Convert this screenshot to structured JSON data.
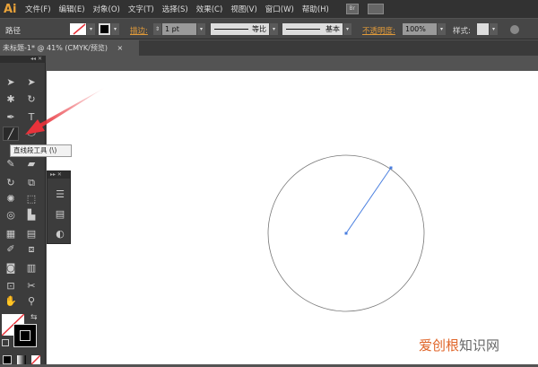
{
  "app": {
    "logo": "Ai",
    "menus": [
      "文件(F)",
      "编辑(E)",
      "对象(O)",
      "文字(T)",
      "选择(S)",
      "效果(C)",
      "视图(V)",
      "窗口(W)",
      "帮助(H)"
    ],
    "bridge": "Br"
  },
  "control": {
    "selection": "路径",
    "stroke_label": "描边:",
    "stroke_weight": "1 pt",
    "profile": "等比",
    "brush": "基本",
    "opacity_label": "不透明度:",
    "opacity": "100%",
    "style_label": "样式:"
  },
  "tab": {
    "title": "未标题-1* @ 41% (CMYK/预览)",
    "close": "×"
  },
  "tooltip": "直线段工具 (\\)",
  "watermark": {
    "part1": "爱创根",
    "part2": "知识网"
  },
  "colors": {
    "accent": "#e09a3a",
    "arrow": "#e8323a",
    "line": "#4a7fe0"
  }
}
